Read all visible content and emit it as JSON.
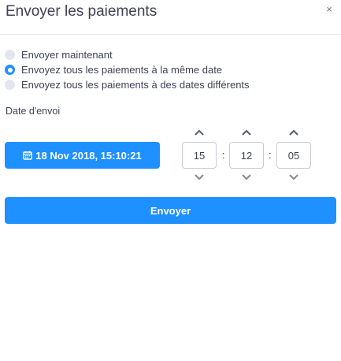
{
  "modal": {
    "title": "Envoyer les paiements",
    "close_label": "×"
  },
  "options": [
    {
      "label": "Envoyer maintenant",
      "checked": false
    },
    {
      "label": "Envoyez tous les paiements à la même date",
      "checked": true
    },
    {
      "label": "Envoyez tous les paiements à des dates différents",
      "checked": false
    }
  ],
  "date_section": {
    "label": "Date d'envoi",
    "datetime": "18 Nov 2018, 15:10:21"
  },
  "time": {
    "hours": "15",
    "minutes": "12",
    "seconds": "05",
    "separator": ":"
  },
  "submit_label": "Envoyer",
  "colors": {
    "accent": "#1e90ff",
    "chevron": "#8a8d9b",
    "chevron_dark": "#5e6278"
  }
}
